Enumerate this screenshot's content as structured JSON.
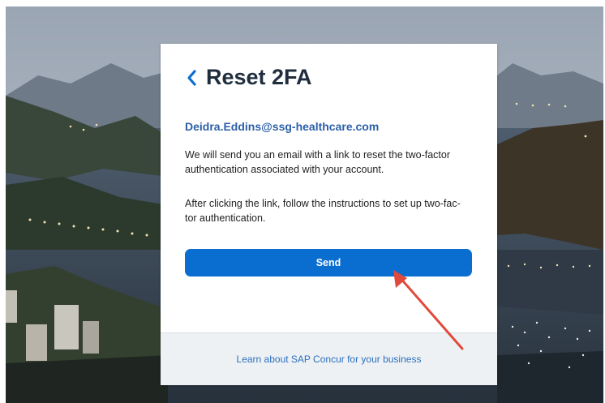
{
  "card": {
    "title": "Reset 2FA",
    "back_icon": "chevron-left-icon",
    "email": "Deidra.Eddins@ssg-healthcare.com",
    "paragraph_1": "We will send you an email with a link to reset the two-factor authentication associated with your account.",
    "paragraph_2": "After clicking the link, follow the instructions to set up two-fac- tor authentication.",
    "send_label": "Send",
    "footer_link": "Learn about SAP Concur for your business"
  },
  "colors": {
    "primary_button": "#0a6ed1",
    "email_text": "#2b5fa8",
    "annotation_arrow": "#e04a3c"
  }
}
